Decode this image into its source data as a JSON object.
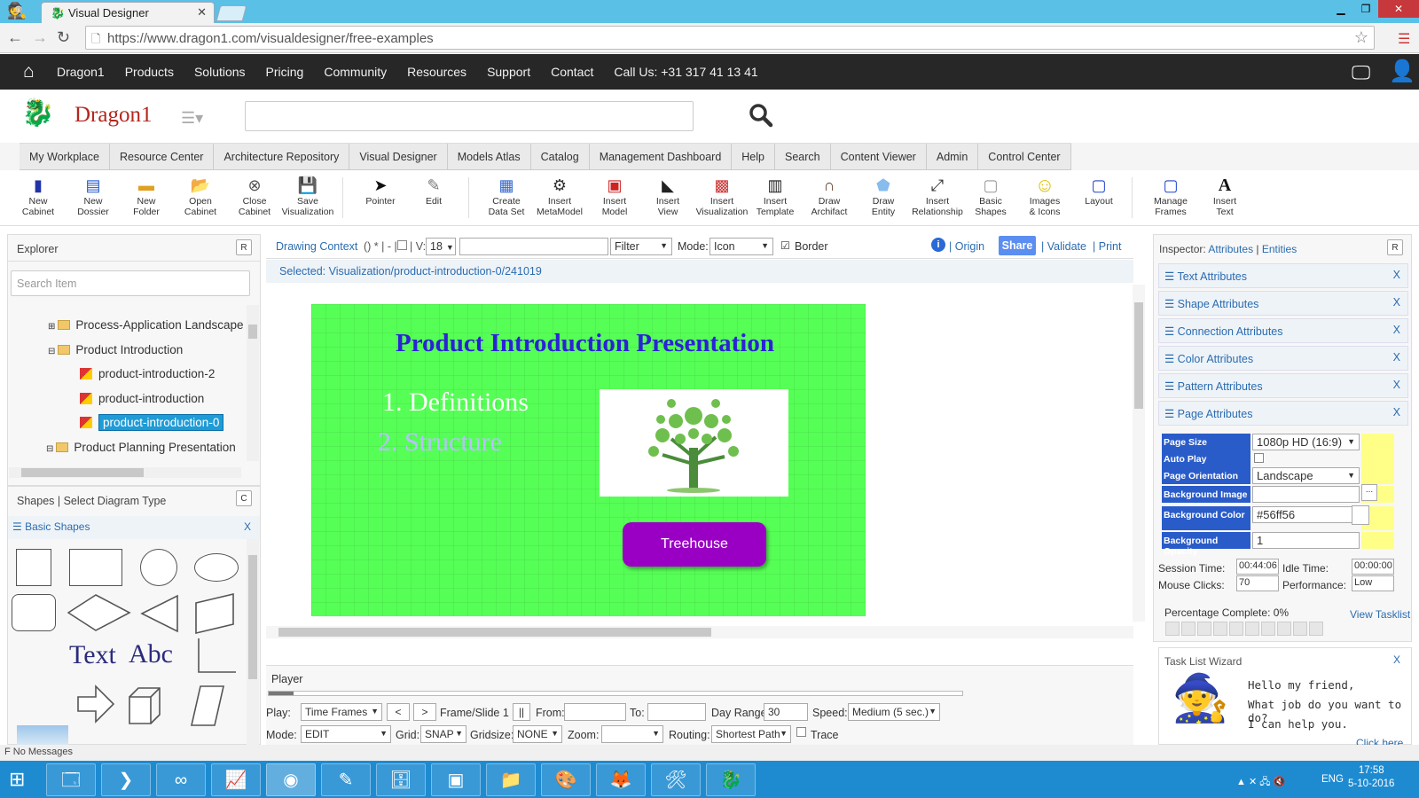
{
  "browser": {
    "tab_title": "Visual Designer",
    "url": "https://www.dragon1.com/visualdesigner/free-examples"
  },
  "topnav": {
    "items": [
      "Dragon1",
      "Products",
      "Solutions",
      "Pricing",
      "Community",
      "Resources",
      "Support",
      "Contact",
      "Call Us: +31 317 41 13 41"
    ]
  },
  "brand": {
    "name": "Dragon1"
  },
  "navtabs": [
    "My Workplace",
    "Resource Center",
    "Architecture Repository",
    "Visual Designer",
    "Models Atlas",
    "Catalog",
    "Management Dashboard",
    "Help",
    "Search",
    "Content Viewer",
    "Admin",
    "Control Center"
  ],
  "toolbar": [
    {
      "l1": "New",
      "l2": "Cabinet",
      "icon": "cabinet-icon"
    },
    {
      "l1": "New",
      "l2": "Dossier",
      "icon": "dossier-icon"
    },
    {
      "l1": "New",
      "l2": "Folder",
      "icon": "folder-icon"
    },
    {
      "l1": "Open",
      "l2": "Cabinet",
      "icon": "open-folder-icon"
    },
    {
      "l1": "Close",
      "l2": "Cabinet",
      "icon": "close-circle-icon"
    },
    {
      "l1": "Save",
      "l2": "Visualization",
      "icon": "floppy-icon"
    },
    {
      "l1": "Pointer",
      "l2": "",
      "icon": "pointer-icon"
    },
    {
      "l1": "Edit",
      "l2": "",
      "icon": "edit-icon"
    },
    {
      "l1": "Create",
      "l2": "Data Set",
      "icon": "dataset-icon"
    },
    {
      "l1": "Insert",
      "l2": "MetaModel",
      "icon": "metamodel-icon"
    },
    {
      "l1": "Insert",
      "l2": "Model",
      "icon": "model-icon"
    },
    {
      "l1": "Insert",
      "l2": "View",
      "icon": "view-icon"
    },
    {
      "l1": "Insert",
      "l2": "Visualization",
      "icon": "visualization-icon"
    },
    {
      "l1": "Insert",
      "l2": "Template",
      "icon": "template-icon"
    },
    {
      "l1": "Draw",
      "l2": "Archifact",
      "icon": "archifact-icon"
    },
    {
      "l1": "Draw",
      "l2": "Entity",
      "icon": "entity-icon"
    },
    {
      "l1": "Insert",
      "l2": "Relationship",
      "icon": "relationship-icon"
    },
    {
      "l1": "Basic",
      "l2": "Shapes",
      "icon": "shapes-icon"
    },
    {
      "l1": "Images",
      "l2": "& Icons",
      "icon": "smiley-icon"
    },
    {
      "l1": "Layout",
      "l2": "",
      "icon": "layout-icon"
    },
    {
      "l1": "Manage",
      "l2": "Frames",
      "icon": "frames-icon"
    },
    {
      "l1": "Insert",
      "l2": "Text",
      "icon": "text-icon"
    }
  ],
  "explorer": {
    "title": "Explorer",
    "btn": "R",
    "search_placeholder": "Search Item",
    "tree": [
      "Process-Application Landscape",
      "Product Introduction",
      "product-introduction-2",
      "product-introduction",
      "product-introduction-0",
      "Product Planning Presentation"
    ]
  },
  "shapes": {
    "title": "Shapes | Select Diagram Type",
    "btn": "C",
    "section": "☰ Basic Shapes",
    "close": "X",
    "text_sample": "Text",
    "abc_sample": "Abc"
  },
  "context": {
    "label": "Drawing Context",
    "misc": "() * | - |",
    "v_label": "| V:",
    "v_value": "18",
    "filter": "Filter",
    "mode_label": "Mode:",
    "mode_value": "Icon",
    "border": "Border",
    "origin": "Origin",
    "share": "Share",
    "validate": "Validate",
    "print": "Print",
    "selected": "Selected: Visualization/product-introduction-0/241019"
  },
  "slide": {
    "title": "Product Introduction Presentation",
    "item1": "1. Definitions",
    "item2": "2. Structure",
    "button": "Treehouse",
    "bg": "#56ff56"
  },
  "player": {
    "title": "Player",
    "play_label": "Play:",
    "play_value": "Time Frames",
    "prev": "<",
    "next": ">",
    "frame": "Frame/Slide 1",
    "pause": "||",
    "from_label": "From:",
    "to_label": "To:",
    "dayrange_label": "Day Range:",
    "dayrange_value": "30",
    "speed_label": "Speed:",
    "speed_value": "Medium (5 sec.)",
    "mode_label": "Mode:",
    "mode_value": "EDIT",
    "grid_label": "Grid:",
    "grid_value": "SNAP",
    "gridsize_label": "Gridsize:",
    "gridsize_value": "NONE",
    "zoom_label": "Zoom:",
    "routing_label": "Routing:",
    "routing_value": "Shortest Path",
    "trace": "Trace"
  },
  "inspector": {
    "title": "Inspector:",
    "attributes": "Attributes",
    "entities": "Entities",
    "btn": "R",
    "sections": [
      "☰ Text Attributes",
      "☰ Shape Attributes",
      "☰ Connection Attributes",
      "☰ Color Attributes",
      "☰ Pattern Attributes",
      "☰ Page Attributes"
    ],
    "props": [
      {
        "k": "Page Size",
        "v": "1080p HD (16:9)"
      },
      {
        "k": "Auto Play",
        "v": ""
      },
      {
        "k": "Page Orientation",
        "v": "Landscape"
      },
      {
        "k": "Background Image",
        "v": ""
      },
      {
        "k": "Background Color",
        "v": "#56ff56"
      },
      {
        "k": "Background Opacity",
        "v": "1"
      }
    ],
    "session_label": "Session Time:",
    "session_value": "00:44:06",
    "idle_label": "Idle Time:",
    "idle_value": "00:00:00",
    "clicks_label": "Mouse Clicks:",
    "clicks_value": "70",
    "perf_label": "Performance:",
    "perf_value": "Low",
    "pct": "Percentage Complete: 0%",
    "view_tasklist": "View Tasklist"
  },
  "wizard": {
    "title": "Task List Wizard",
    "close": "X",
    "line1": "Hello my friend,",
    "line2": "What job do you want to do?",
    "line3": "I can help you.",
    "link": "Click here"
  },
  "status": "F No Messages",
  "clock": {
    "time": "17:58",
    "date": "5-10-2016",
    "lang": "ENG"
  }
}
